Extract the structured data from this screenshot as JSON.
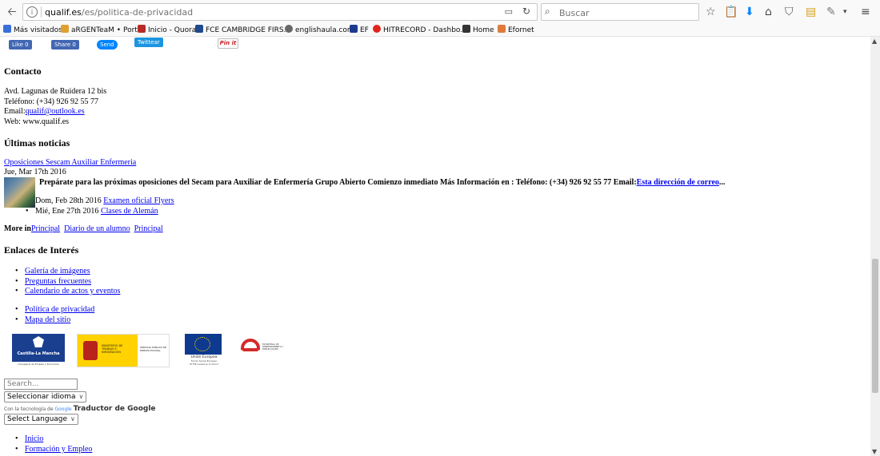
{
  "browser": {
    "url_domain": "qualif.es",
    "url_path": "/es/politica-de-privacidad",
    "search_placeholder": "Buscar",
    "bookmarks": [
      {
        "label": "Más visitados",
        "color": "#3a6fd8"
      },
      {
        "label": "aRGENTeaM • Portal",
        "color": "#e0a030"
      },
      {
        "label": "Inicio - Quora",
        "color": "#b92b27"
      },
      {
        "label": "FCE CAMBRIDGE FIRS...",
        "color": "#1e4a8c"
      },
      {
        "label": "englishaula.com",
        "color": "#666666"
      },
      {
        "label": "EF",
        "color": "#1c3b8f"
      },
      {
        "label": "HITRECORD - Dashbo...",
        "color": "#e0261b"
      },
      {
        "label": "Home",
        "color": "#333333"
      },
      {
        "label": "Efornet",
        "color": "#e07a3a"
      }
    ]
  },
  "social": {
    "like": "Like 0",
    "share": "Share 0",
    "send": "Send",
    "tweet": "Twittear",
    "pin": "Pin it"
  },
  "contact": {
    "heading": "Contacto",
    "address": "Avd. Lagunas de Ruidera 12 bis",
    "phone": "Teléfono: (+34) 926 92 55 77",
    "email_label": "Email:",
    "email": "qualif@outlook.es",
    "web": "Web: www.qualif.es"
  },
  "news": {
    "heading": "Últimas noticias",
    "featured_title": "Oposiciones Sescam Auxiliar Enfermeria",
    "featured_date": "Jue, Mar 17th 2016",
    "featured_text": "Prepárate para las próximas oposiciones del Secam para Auxiliar de Enfermería   Grupo Abierto Comienzo inmediato   Más Información en :  Teléfono: (+34) 926 92 55 77 Email:",
    "featured_link": "Esta dirección de correo",
    "ellipsis": "...",
    "item1_date": "Dom, Feb 28th 2016",
    "item1_link": "Examen oficial Flyers",
    "item2_date": "Mié, Ene 27th 2016",
    "item2_link": "Clases de Alemán",
    "more_label": "More in",
    "more_links": [
      "Principal",
      "Diario de un alumno",
      "Principal"
    ]
  },
  "links": {
    "heading": "Enlaces de Interés",
    "group1": [
      "Galería de imágenes",
      "Preguntas frecuentes",
      "Calendario de actos y eventos"
    ],
    "group2": [
      "Política de privacidad",
      "Mapa del sitio"
    ]
  },
  "logos": {
    "clm_name": "Castilla-La Mancha",
    "clm_sub": "Consejería de Empleo y Economía",
    "ministerio_text": "MINISTERIO DE TRABAJO E INMIGRACIÓN",
    "sepe_text": "SERVICIO PÚBLICO DE EMPLEO ESTATAL",
    "eu_name": "Unión Europea",
    "eu_sub": "Fondo Social Europeo",
    "eu_motto": "\"El FSE invierte en tu futuro\"",
    "garantia_text": "ESTRATEGIA DE EMPRENDIMIENTO Y EMPLEO JOVEN"
  },
  "form": {
    "search_placeholder": "Search...",
    "language_select": "Seleccionar idioma",
    "google_prefix": "Con la tecnología de",
    "google_brand": "Google",
    "google_suffix": "Traductor de Google",
    "select_language": "Select Language"
  },
  "menu": [
    "Inicio",
    "Formación y Empleo"
  ]
}
